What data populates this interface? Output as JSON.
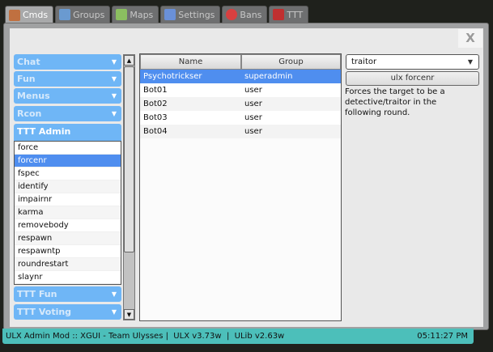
{
  "tabs": [
    {
      "label": "Cmds",
      "icon": "user-icon",
      "color": "#c07040"
    },
    {
      "label": "Groups",
      "icon": "group-icon",
      "color": "#6a9ad0"
    },
    {
      "label": "Maps",
      "icon": "map-icon",
      "color": "#8bbf60"
    },
    {
      "label": "Settings",
      "icon": "wrench-icon",
      "color": "#6a90d8"
    },
    {
      "label": "Bans",
      "icon": "ban-icon",
      "color": "#d84040"
    },
    {
      "label": "TTT",
      "icon": "ttt-icon",
      "color": "#c03030"
    }
  ],
  "close_label": "X",
  "categories": [
    "Chat",
    "Fun",
    "Menus",
    "Rcon",
    "TTT Admin",
    "TTT Fun",
    "TTT Voting"
  ],
  "commands": [
    "force",
    "forcenr",
    "fspec",
    "identify",
    "impairnr",
    "karma",
    "removebody",
    "respawn",
    "respawntp",
    "roundrestart",
    "slaynr"
  ],
  "table": {
    "headers": [
      "Name",
      "Group"
    ],
    "rows": [
      [
        "Psychotrickser",
        "superadmin"
      ],
      [
        "Bot01",
        "user"
      ],
      [
        "Bot02",
        "user"
      ],
      [
        "Bot03",
        "user"
      ],
      [
        "Bot04",
        "user"
      ]
    ]
  },
  "role_select": "traitor",
  "run_button": "ulx forcenr",
  "description": "Forces the target to be a detective/traitor in the following round.",
  "status": {
    "text": "ULX Admin Mod :: XGUI - Team Ulysses |  ULX v3.73w  |  ULib v2.63w",
    "time": "05:11:27 PM"
  }
}
